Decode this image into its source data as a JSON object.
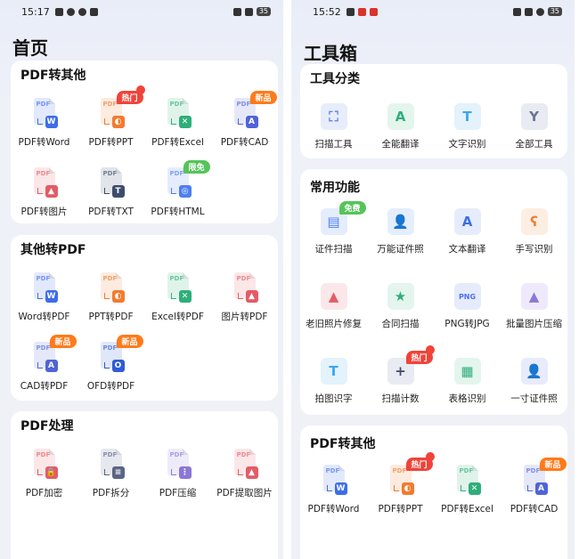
{
  "left": {
    "status": {
      "time": "15:17",
      "battery": "35"
    },
    "title": "首页",
    "sections": [
      {
        "title": "PDF转其他",
        "items": [
          {
            "label": "PDF转Word",
            "badge": "W",
            "color": "#3d6ee8",
            "tag": ""
          },
          {
            "label": "PDF转PPT",
            "badge": "◐",
            "color": "#f27b2f",
            "tag": "热门"
          },
          {
            "label": "PDF转Excel",
            "badge": "✕",
            "color": "#2fae7a",
            "tag": ""
          },
          {
            "label": "PDF转CAD",
            "badge": "A",
            "color": "#5064d8",
            "tag": "新品"
          },
          {
            "label": "PDF转图片",
            "badge": "▲",
            "color": "#e35b66",
            "tag": ""
          },
          {
            "label": "PDF转TXT",
            "badge": "T",
            "color": "#3e4c6b",
            "tag": ""
          },
          {
            "label": "PDF转HTML",
            "badge": "◎",
            "color": "#4d7ef0",
            "tag": "限免"
          }
        ]
      },
      {
        "title": "其他转PDF",
        "items": [
          {
            "label": "Word转PDF",
            "badge": "W",
            "color": "#3d6ee8",
            "tag": ""
          },
          {
            "label": "PPT转PDF",
            "badge": "◐",
            "color": "#f27b2f",
            "tag": ""
          },
          {
            "label": "Excel转PDF",
            "badge": "✕",
            "color": "#2fae7a",
            "tag": ""
          },
          {
            "label": "图片转PDF",
            "badge": "▲",
            "color": "#e35b66",
            "tag": ""
          },
          {
            "label": "CAD转PDF",
            "badge": "A",
            "color": "#5064d8",
            "tag": "新品"
          },
          {
            "label": "OFD转PDF",
            "badge": "O",
            "color": "#2f5bd6",
            "tag": "新品"
          }
        ]
      },
      {
        "title": "PDF处理",
        "items": [
          {
            "label": "PDF加密",
            "badge": "🔒",
            "color": "#e35b66",
            "tag": ""
          },
          {
            "label": "PDF拆分",
            "badge": "≡",
            "color": "#5a6584",
            "tag": ""
          },
          {
            "label": "PDF压缩",
            "badge": "⋮",
            "color": "#8a78d6",
            "tag": ""
          },
          {
            "label": "PDF提取图片",
            "badge": "▲",
            "color": "#e35b66",
            "tag": ""
          }
        ]
      }
    ]
  },
  "right": {
    "status": {
      "time": "15:52",
      "battery": "35"
    },
    "title": "工具箱",
    "sections": [
      {
        "title": "工具分类",
        "items": [
          {
            "label": "扫描工具",
            "glyph": "⛶",
            "color": "#5b7fe6",
            "bg": "#e7edfb",
            "tag": ""
          },
          {
            "label": "全能翻译",
            "glyph": "A",
            "color": "#2fae7a",
            "bg": "#e4f5ee",
            "tag": ""
          },
          {
            "label": "文字识别",
            "glyph": "T",
            "color": "#3aa8e8",
            "bg": "#e3f2fb",
            "tag": ""
          },
          {
            "label": "全部工具",
            "glyph": "Y",
            "color": "#6b7694",
            "bg": "#e9ebf2",
            "tag": ""
          }
        ]
      },
      {
        "title": "常用功能",
        "items": [
          {
            "label": "证件扫描",
            "glyph": "▤",
            "color": "#4b7ef0",
            "bg": "#e5edfd",
            "tag": "免费"
          },
          {
            "label": "万能证件照",
            "glyph": "👤",
            "color": "#3d7ff0",
            "bg": "#e5eefd",
            "tag": ""
          },
          {
            "label": "文本翻译",
            "glyph": "A",
            "color": "#3d6ee8",
            "bg": "#e6ecfb",
            "tag": ""
          },
          {
            "label": "手写识别",
            "glyph": "ʕ",
            "color": "#f27b2f",
            "bg": "#fdeee2",
            "tag": ""
          },
          {
            "label": "老旧照片修复",
            "glyph": "▲",
            "color": "#e35b66",
            "bg": "#fbe7e9",
            "tag": ""
          },
          {
            "label": "合同扫描",
            "glyph": "★",
            "color": "#2fae7a",
            "bg": "#e4f5ee",
            "tag": ""
          },
          {
            "label": "PNG转JPG",
            "glyph": "PNG",
            "color": "#4d6ef0",
            "bg": "#e6ebfb",
            "tag": ""
          },
          {
            "label": "批量图片压缩",
            "glyph": "▲",
            "color": "#8a78d6",
            "bg": "#efeafb",
            "tag": ""
          },
          {
            "label": "拍图识字",
            "glyph": "T",
            "color": "#3aa8e8",
            "bg": "#e3f2fb",
            "tag": ""
          },
          {
            "label": "扫描计数",
            "glyph": "+",
            "color": "#3e4c6b",
            "bg": "#e9ebf2",
            "tag": "热门"
          },
          {
            "label": "表格识别",
            "glyph": "▦",
            "color": "#2fae7a",
            "bg": "#e4f5ee",
            "tag": ""
          },
          {
            "label": "一寸证件照",
            "glyph": "👤",
            "color": "#5b6fd8",
            "bg": "#e8ebfb",
            "tag": ""
          }
        ]
      },
      {
        "title": "PDF转其他",
        "items": [
          {
            "label": "PDF转Word",
            "badge": "W",
            "color": "#3d6ee8",
            "tag": ""
          },
          {
            "label": "PDF转PPT",
            "badge": "◐",
            "color": "#f27b2f",
            "tag": "热门"
          },
          {
            "label": "PDF转Excel",
            "badge": "✕",
            "color": "#2fae7a",
            "tag": ""
          },
          {
            "label": "PDF转CAD",
            "badge": "A",
            "color": "#5064d8",
            "tag": "新品"
          }
        ]
      }
    ]
  }
}
